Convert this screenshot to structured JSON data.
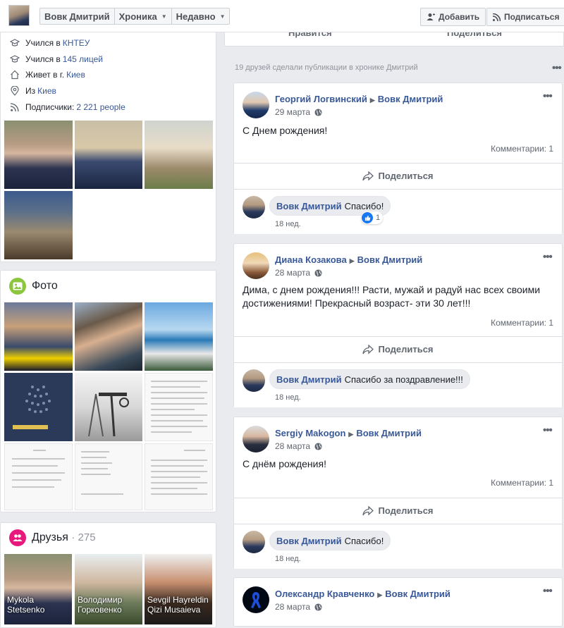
{
  "topbar": {
    "profile_name": "Вовк Дмитрий",
    "timeline_label": "Хроника",
    "recent_label": "Недавно",
    "add_label": "Добавить",
    "subscribe_label": "Подписаться"
  },
  "intro": {
    "rows": [
      {
        "icon": "graduation-cap-icon",
        "prefix": "Учился в",
        "link": "КНТЕУ"
      },
      {
        "icon": "graduation-cap-icon",
        "prefix": "Учился в",
        "link": "145 лицей"
      },
      {
        "icon": "home-icon",
        "prefix": "Живет в г.",
        "link": "Киев"
      },
      {
        "icon": "location-pin-icon",
        "prefix": "Из",
        "link": "Киев"
      },
      {
        "icon": "rss-icon",
        "prefix": "Подписчики:",
        "link": "2 221 people"
      }
    ]
  },
  "photos_section": {
    "title": "Фото"
  },
  "friends_section": {
    "title": "Друзья",
    "count": "· 275",
    "friends": [
      {
        "name": "Mykola Stetsenko"
      },
      {
        "name": "Володимир Горковенко"
      },
      {
        "name": "Sevgil Hayreldin Qizi Musaieva"
      }
    ]
  },
  "top_actions": {
    "like": "Нравится",
    "share": "Поделиться"
  },
  "feed": {
    "heading": "19 друзей сделали публикации в хронике Дмитрий",
    "more": "•••",
    "posts": [
      {
        "author": "Георгий Логвинский",
        "target": "Вовк Дмитрий",
        "date": "29 марта",
        "text": "С Днем рождения!",
        "comments": "Комментарии: 1",
        "share": "Поделиться",
        "reply": {
          "author": "Вовк Дмитрий",
          "text": "Спасибо!",
          "time": "18 нед.",
          "likes": "1"
        }
      },
      {
        "author": "Диана Козакова",
        "target": "Вовк Дмитрий",
        "date": "28 марта",
        "text_line1": "Дима, с днем рождения!!! Расти, мужай и радуй нас всех своими",
        "text_line2": "достижениями! Прекрасный возраст- эти 30 лет!!!",
        "comments": "Комментарии: 1",
        "share": "Поделиться",
        "reply": {
          "author": "Вовк Дмитрий",
          "text": "Спасибо за поздравление!!!",
          "time": "18 нед."
        }
      },
      {
        "author": "Sergiy Makogon",
        "target": "Вовк Дмитрий",
        "date": "28 марта",
        "text": "С днём рождения!",
        "comments": "Комментарии: 1",
        "share": "Поделиться",
        "reply": {
          "author": "Вовк Дмитрий",
          "text": "Спасибо!",
          "time": "18 нед."
        }
      },
      {
        "author": "Олександр Кравченко",
        "target": "Вовк Дмитрий",
        "date": "28 марта"
      }
    ]
  },
  "colors": {
    "link": "#385898",
    "background": "#e9ebee",
    "like_blue": "#1877f2"
  }
}
